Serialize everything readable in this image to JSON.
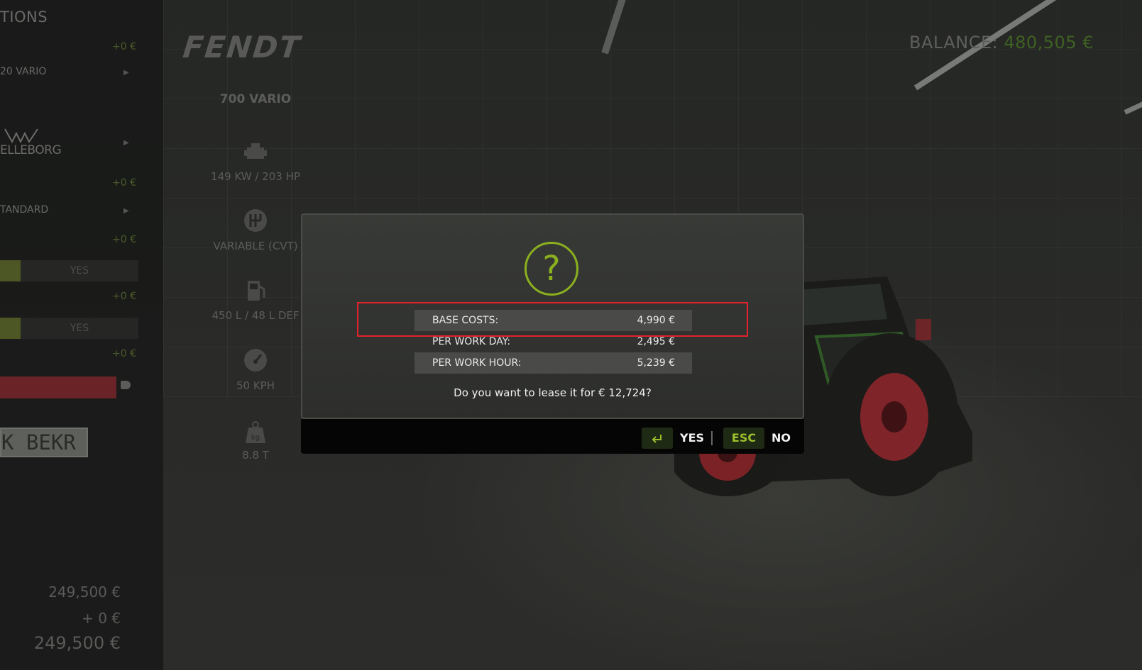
{
  "header": {
    "left_title": "TIONS",
    "brand": "FENDT",
    "model": "700 VARIO",
    "balance_label": "BALANCE:",
    "balance_value": "480,505 €"
  },
  "options": {
    "prices": [
      "+0 €",
      "+0 €",
      "+0 €",
      "+0 €",
      "+0 €"
    ],
    "items": [
      {
        "label": "20 VARIO"
      },
      {
        "label": "ELLEBORG"
      },
      {
        "label": "TANDARD"
      }
    ],
    "toggles": [
      "YES",
      "YES"
    ],
    "plate": "K BEKR"
  },
  "specs": [
    {
      "icon": "engine-icon",
      "text": "149 KW / 203 HP"
    },
    {
      "icon": "gearbox-icon",
      "text": "VARIABLE (CVT)"
    },
    {
      "icon": "fuel-icon",
      "text": "450 L / 48 L DEF"
    },
    {
      "icon": "speedometer-icon",
      "text": "50 KPH"
    },
    {
      "icon": "weight-icon",
      "text": "8.8 T"
    }
  ],
  "totals": {
    "base": "249,500 €",
    "extra": "+ 0 €",
    "total": "249,500 €"
  },
  "dialog": {
    "icon": "question-icon",
    "icon_text": "?",
    "rows": [
      {
        "label": "BASE COSTS:",
        "value": "4,990 €"
      },
      {
        "label": "PER WORK DAY:",
        "value": "2,495 €"
      },
      {
        "label": "PER WORK HOUR:",
        "value": "5,239 €"
      }
    ],
    "question": "Do you want to lease it for € 12,724?",
    "yes_key": "enter-icon",
    "yes_label": "YES",
    "no_key": "ESC",
    "no_label": "NO"
  },
  "colors": {
    "accent": "#8bb01e",
    "highlight": "#e2222c",
    "balance": "#3f6122"
  }
}
